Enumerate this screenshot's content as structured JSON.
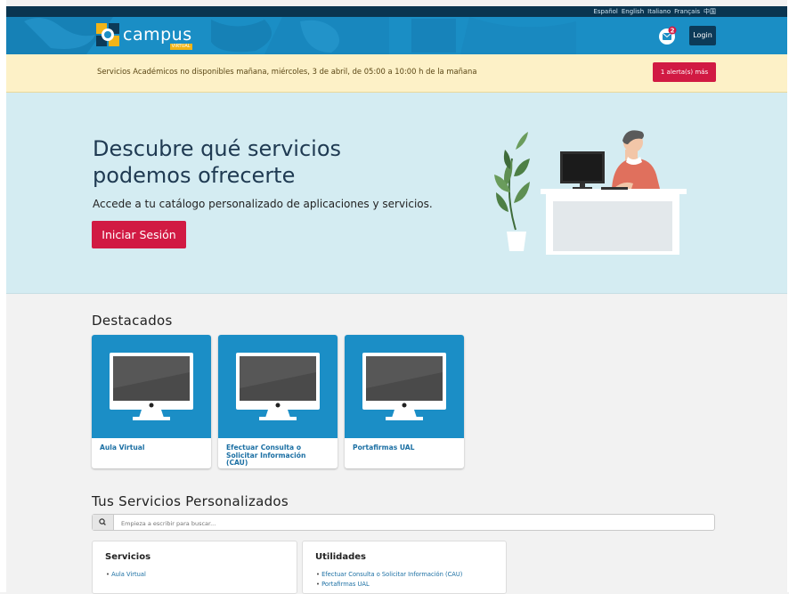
{
  "languages": [
    "Español",
    "English",
    "Italiano",
    "Français",
    "中国"
  ],
  "header": {
    "logo_word": "campus",
    "logo_sub": "VIRTUAL",
    "mail_badge": "2",
    "login_label": "Login"
  },
  "alert": {
    "message": "Servicios Académicos no disponibles mañana, miércoles, 3 de abril, de 05:00 a 10:00 h de la mañana",
    "more_label": "1 alerta(s) más"
  },
  "hero": {
    "title": "Descubre qué servicios podemos ofrecerte",
    "subtitle": "Accede a tu catálogo personalizado de aplicaciones y servicios.",
    "button_label": "Iniciar Sesión"
  },
  "featured": {
    "title": "Destacados",
    "cards": [
      {
        "label": "Aula Virtual"
      },
      {
        "label": "Efectuar Consulta o Solicitar Información (CAU)"
      },
      {
        "label": "Portafirmas UAL"
      }
    ]
  },
  "services": {
    "title": "Tus Servicios Personalizados",
    "search_placeholder": "Empieza a escribir para buscar...",
    "panels": [
      {
        "title": "Servicios",
        "items": [
          "Aula Virtual"
        ]
      },
      {
        "title": "Utilidades",
        "items": [
          "Efectuar Consulta o Solicitar Información (CAU)",
          "Portafirmas UAL"
        ]
      }
    ]
  },
  "colors": {
    "header_blue": "#1a8ec5",
    "top_bar": "#0a3550",
    "accent_red": "#d11a43",
    "alert_bg": "#fdf1c7",
    "hero_bg": "#d4ecf2",
    "link_blue": "#1b6fa3"
  }
}
